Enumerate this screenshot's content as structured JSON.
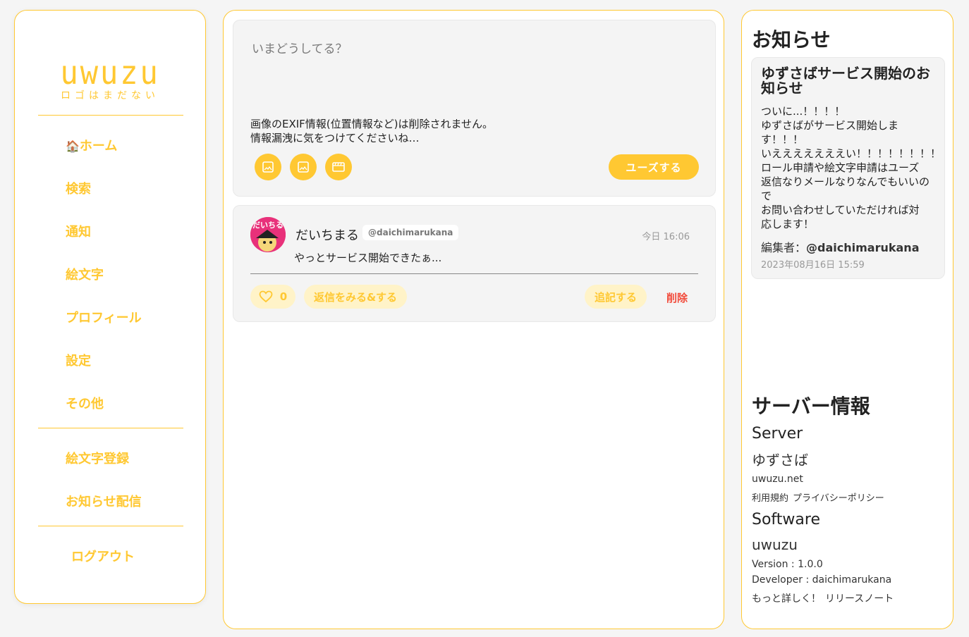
{
  "sidebar": {
    "logo_main": "uwuzu",
    "logo_sub": "ロゴはまだない",
    "nav": [
      {
        "label": "ホーム",
        "icon": "house-icon"
      },
      {
        "label": "検索"
      },
      {
        "label": "通知"
      },
      {
        "label": "絵文字"
      },
      {
        "label": "プロフィール"
      },
      {
        "label": "設定"
      },
      {
        "label": "その他"
      }
    ],
    "admin": [
      {
        "label": "絵文字登録"
      },
      {
        "label": "お知らせ配信"
      }
    ],
    "logout": "ログアウト"
  },
  "composer": {
    "placeholder": "いまどうしてる？",
    "note_line1": "画像のEXIF情報(位置情報など)は削除されません。",
    "note_line2": "情報漏洩に気をつけてくださいね…",
    "tools": [
      "image-icon",
      "image-icon",
      "video-icon"
    ],
    "submit_label": "ユーズする"
  },
  "post": {
    "avatar_text": "だいちる",
    "name": "だいちまる",
    "handle": "@daichimarukana",
    "time": "今日 16:06",
    "text": "やっとサービス開始できたぁ...",
    "like_count": "0",
    "reply_label": "返信をみる&する",
    "append_label": "追記する",
    "delete_label": "削除"
  },
  "notice": {
    "heading": "お知らせ",
    "card_title": "ゆずさばサービス開始のお知らせ",
    "body": "ついに...！！！！\nゆずさばがサービス開始しま\nす！！！\nいえええええええい！！！！！！！！\nロール申請や絵文字申請はユーズ\n返信なりメールなりなんでもいいの\nで\nお問い合わせしていただければ対\n応します！",
    "editor_label": "編集者：",
    "editor": "@daichimarukana",
    "date": "2023年08月16日 15:59"
  },
  "server": {
    "heading": "サーバー情報",
    "server_label": "Server",
    "server_name": "ゆずさば",
    "domain": "uwuzu.net",
    "terms": "利用規約",
    "privacy": "プライバシーポリシー",
    "software_label": "Software",
    "software_name": "uwuzu",
    "version": "Version : 1.0.0",
    "developer": "Developer : daichimarukana",
    "more": "もっと詳しく！",
    "release_notes": "リリースノート"
  },
  "colors": {
    "accent": "#ffc832",
    "accent_light": "#fff3c8",
    "danger": "#f24a3a",
    "card_bg": "#f4f4f4"
  }
}
